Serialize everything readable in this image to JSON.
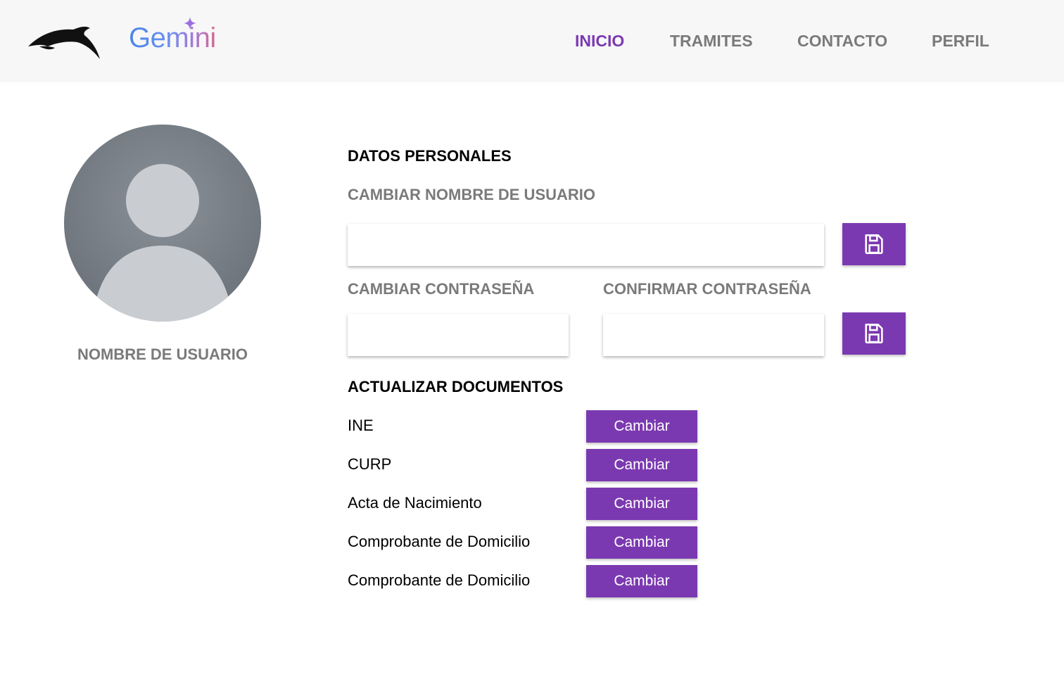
{
  "header": {
    "brand": "Gemini",
    "nav": [
      {
        "label": "INICIO",
        "active": true
      },
      {
        "label": "TRAMITES",
        "active": false
      },
      {
        "label": "CONTACTO",
        "active": false
      },
      {
        "label": "PERFIL",
        "active": false
      }
    ]
  },
  "profile": {
    "username": "NOMBRE DE USUARIO"
  },
  "personal": {
    "title": "DATOS PERSONALES",
    "change_username_label": "CAMBIAR NOMBRE DE USUARIO",
    "change_username_value": "",
    "change_password_label": "CAMBIAR CONTRASEÑA",
    "change_password_value": "",
    "confirm_password_label": "CONFIRMAR CONTRASEÑA",
    "confirm_password_value": ""
  },
  "documents": {
    "title": "ACTUALIZAR DOCUMENTOS",
    "items": [
      {
        "label": "INE",
        "button": "Cambiar"
      },
      {
        "label": "CURP",
        "button": "Cambiar"
      },
      {
        "label": "Acta de Nacimiento",
        "button": "Cambiar"
      },
      {
        "label": "Comprobante de Domicilio",
        "button": "Cambiar"
      },
      {
        "label": "Comprobante de Domicilio",
        "button": "Cambiar"
      }
    ]
  },
  "icons": {
    "logo": "dolphin-logo-icon",
    "sparkle": "sparkle-icon",
    "save": "floppy-disk-icon"
  },
  "colors": {
    "accent": "#7b39b1",
    "header_bg": "#f7f7f7",
    "muted_text": "#7a7a7a"
  }
}
